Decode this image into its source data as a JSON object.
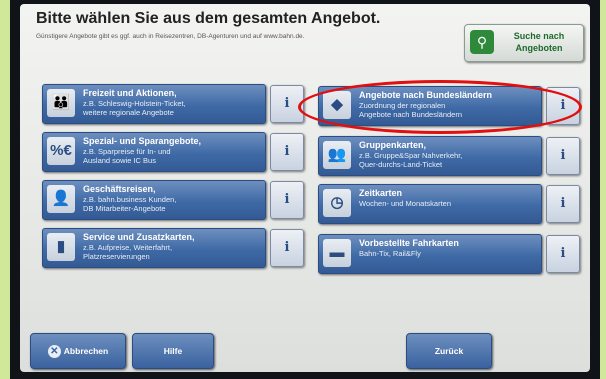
{
  "header": {
    "title": "Bitte wählen Sie aus dem gesamten Angebot.",
    "subtitle": "Günstigere Angebote gibt es ggf. auch in Reisezentren, DB-Agenturen und auf www.bahn.de.",
    "search_button": "Suche nach\nAngeboten"
  },
  "tiles_left": [
    {
      "title": "Freizeit und Aktionen,",
      "desc": "z.B. Schleswig-Holstein-Ticket,\nweitere regionale Angebote",
      "icon": "family-icon"
    },
    {
      "title": "Spezial- und Sparangebote,",
      "desc": "z.B. Sparpreise für In- und\nAusland sowie IC Bus",
      "icon": "percent-euro-icon"
    },
    {
      "title": "Geschäftsreisen,",
      "desc": "z.B. bahn.business Kunden,\nDB Mitarbeiter-Angebote",
      "icon": "businessman-icon"
    },
    {
      "title": "Service und Zusatzkarten,",
      "desc": "z.B. Aufpreise, Weiterfahrt,\nPlatzreservierungen",
      "icon": "service-icon"
    }
  ],
  "tiles_right": [
    {
      "title": "Angebote nach Bundesländern",
      "desc": "Zuordnung der regionalen\nAngebote nach Bundesländern",
      "icon": "germany-map-icon"
    },
    {
      "title": "Gruppenkarten,",
      "desc": "z.B. Gruppe&Spar Nahverkehr,\nQuer-durchs-Land-Ticket",
      "icon": "group-icon"
    },
    {
      "title": "Zeitkarten",
      "desc": "Wochen- und Monatskarten",
      "icon": "clock-calendar-icon"
    },
    {
      "title": "Vorbestellte Fahrkarten",
      "desc": "Bahn-Tix, Rail&Fly",
      "icon": "ticket-icon"
    }
  ],
  "info_label": "i",
  "footer": {
    "cancel": "Abbrechen",
    "help": "Hilfe",
    "back": "Zurück"
  },
  "colors": {
    "tile": "#3f6aa6",
    "highlight": "#e01010",
    "search_icon": "#2e8a3a"
  }
}
